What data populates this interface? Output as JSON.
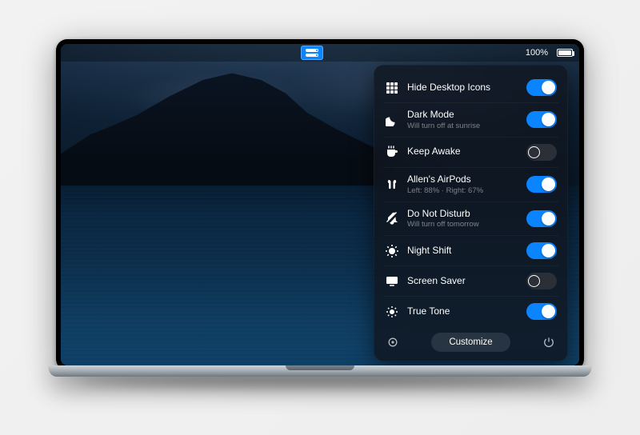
{
  "menubar": {
    "battery_percent_label": "100%"
  },
  "panel": {
    "items": [
      {
        "key": "hide-desktop-icons",
        "icon": "grid-icon",
        "label": "Hide Desktop Icons",
        "sub": "",
        "on": true
      },
      {
        "key": "dark-mode",
        "icon": "moon-icon",
        "label": "Dark Mode",
        "sub": "Will turn off at sunrise",
        "on": true
      },
      {
        "key": "keep-awake",
        "icon": "coffee-icon",
        "label": "Keep Awake",
        "sub": "",
        "on": false
      },
      {
        "key": "airpods",
        "icon": "airpods-icon",
        "label": "Allen's AirPods",
        "sub": "Left: 88% · Right: 67%",
        "on": true
      },
      {
        "key": "do-not-disturb",
        "icon": "dnd-icon",
        "label": "Do Not Disturb",
        "sub": "Will turn off tomorrow",
        "on": true
      },
      {
        "key": "night-shift",
        "icon": "nightshift-icon",
        "label": "Night Shift",
        "sub": "",
        "on": true
      },
      {
        "key": "screen-saver",
        "icon": "display-icon",
        "label": "Screen Saver",
        "sub": "",
        "on": false
      },
      {
        "key": "true-tone",
        "icon": "truetone-icon",
        "label": "True Tone",
        "sub": "",
        "on": true
      }
    ],
    "customize_label": "Customize"
  },
  "colors": {
    "accent": "#0a84ff"
  }
}
